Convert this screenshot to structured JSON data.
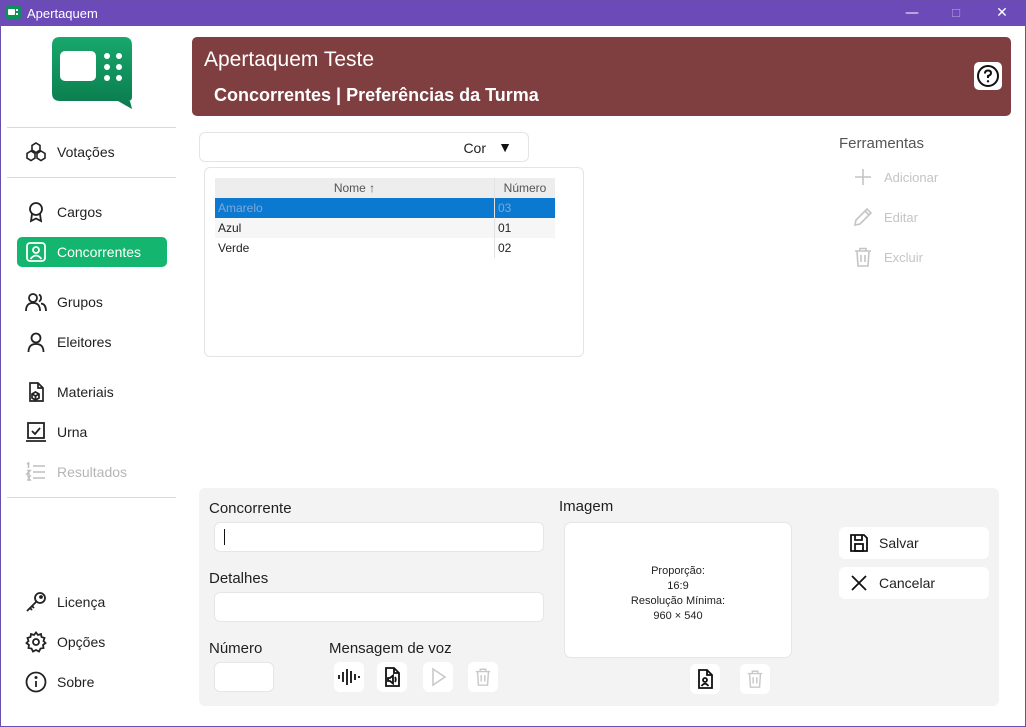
{
  "window": {
    "title": "Apertaquem",
    "controls": {
      "minimize": "—",
      "maximize": "☐",
      "close": "✕"
    }
  },
  "sidebar": {
    "items": [
      {
        "label": "Votações",
        "icon": "cubes-icon",
        "state": "normal"
      },
      {
        "label": "Cargos",
        "icon": "ribbon-icon",
        "state": "normal"
      },
      {
        "label": "Concorrentes",
        "icon": "contact-card-icon",
        "state": "active"
      },
      {
        "label": "Grupos",
        "icon": "people-icon",
        "state": "normal"
      },
      {
        "label": "Eleitores",
        "icon": "person-icon",
        "state": "normal"
      },
      {
        "label": "Materiais",
        "icon": "document-cube-icon",
        "state": "normal"
      },
      {
        "label": "Urna",
        "icon": "ballot-box-icon",
        "state": "normal"
      },
      {
        "label": "Resultados",
        "icon": "numbered-list-icon",
        "state": "disabled"
      }
    ],
    "bottom_items": [
      {
        "label": "Licença",
        "icon": "key-icon"
      },
      {
        "label": "Opções",
        "icon": "gear-icon"
      },
      {
        "label": "Sobre",
        "icon": "info-icon"
      }
    ]
  },
  "header": {
    "title": "Apertaquem Teste",
    "subtitle": "Concorrentes | Preferências da Turma",
    "help_icon": "question-circle-icon",
    "background": "#7f3e3f"
  },
  "filter": {
    "label": "Cor",
    "arrow": "▼"
  },
  "table": {
    "columns": [
      "Nome ↑",
      "Número"
    ],
    "rows": [
      {
        "nome": "Amarelo",
        "numero": "03",
        "selected": true
      },
      {
        "nome": "Azul",
        "numero": "01",
        "selected": false
      },
      {
        "nome": "Verde",
        "numero": "02",
        "selected": false
      }
    ]
  },
  "tools": {
    "title": "Ferramentas",
    "items": [
      {
        "label": "Adicionar",
        "icon": "plus-icon"
      },
      {
        "label": "Editar",
        "icon": "pencil-icon"
      },
      {
        "label": "Excluir",
        "icon": "trash-icon"
      }
    ]
  },
  "form": {
    "concorrente_label": "Concorrente",
    "concorrente_value": "",
    "detalhes_label": "Detalhes",
    "detalhes_value": "",
    "numero_label": "Número",
    "numero_value": "",
    "voz_label": "Mensagem de voz",
    "imagem_label": "Imagem",
    "image_info": {
      "proporcao_label": "Proporção:",
      "proporcao_value": "16:9",
      "resolucao_label": "Resolução Mínima:",
      "resolucao_value": "960 × 540"
    },
    "salvar_label": "Salvar",
    "cancelar_label": "Cancelar"
  },
  "colors": {
    "titlebar": "#6c4bb8",
    "accent_green": "#14b56e",
    "selection_blue": "#0b79d0"
  }
}
